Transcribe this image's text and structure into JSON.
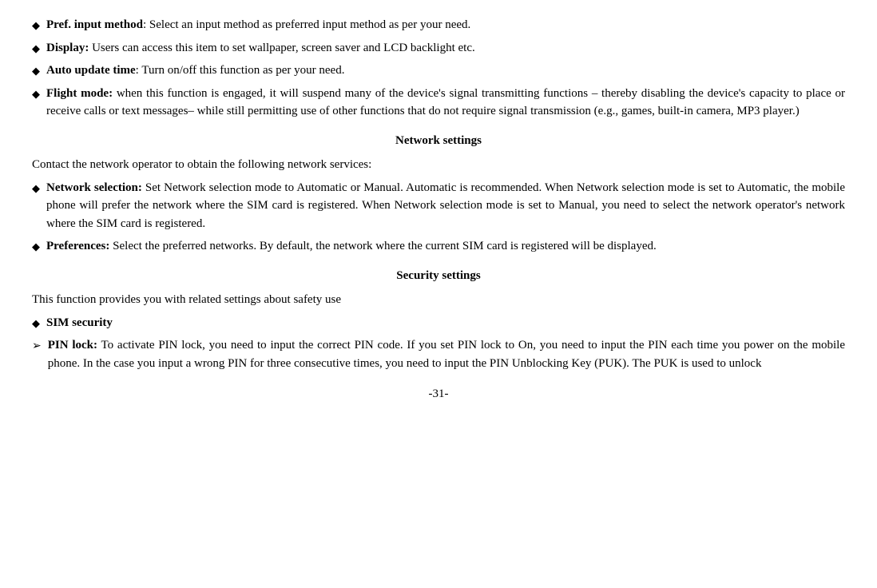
{
  "bullets": [
    {
      "id": "pref-input",
      "bold": "Pref. input method",
      "rest": ": Select an input method as preferred input method as per your need."
    },
    {
      "id": "display",
      "bold": "Display:",
      "rest": " Users can access this item to set wallpaper, screen saver and LCD backlight etc."
    },
    {
      "id": "auto-update",
      "bold": "Auto update time",
      "rest": ": Turn on/off this function as per your need."
    },
    {
      "id": "flight-mode",
      "bold": "Flight mode:",
      "rest": " when this function is engaged, it will suspend many of the device's signal transmitting functions – thereby disabling the device's capacity to place or receive calls or text messages– while still permitting use of other functions that do not require signal transmission (e.g., games, built-in camera, MP3 player.)"
    }
  ],
  "network_heading": "Network settings",
  "network_intro": "Contact the network operator to obtain the following network services:",
  "network_bullets": [
    {
      "id": "network-selection",
      "bold": "Network selection:",
      "rest": " Set Network selection mode to Automatic or Manual. Automatic is recommended. When Network selection mode is set to Automatic, the mobile phone will prefer the network where the SIM card is registered. When Network selection mode is set to Manual, you need to select the network operator's network where the SIM card is registered."
    },
    {
      "id": "preferences",
      "bold": "Preferences:",
      "rest": " Select the preferred networks. By default, the network where the current SIM card is registered will be displayed."
    }
  ],
  "security_heading": "Security settings",
  "security_intro": "This function provides you with related settings about safety use",
  "security_bullets": [
    {
      "id": "sim-security",
      "bold": "SIM security",
      "rest": "",
      "type": "diamond"
    }
  ],
  "pin_lock": {
    "bold": "PIN lock:",
    "rest": " To activate PIN lock, you need to input the correct PIN code. If you set PIN lock to On, you need to input the PIN each time you power on the mobile phone. In the case you input a wrong PIN for three consecutive times, you need to input the PIN Unblocking Key (PUK). The PUK is used to unlock"
  },
  "page_number": "-31-"
}
